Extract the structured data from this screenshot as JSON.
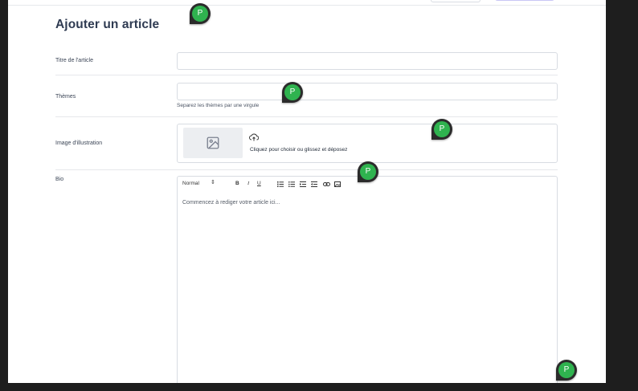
{
  "page": {
    "title": "Ajouter un article"
  },
  "form": {
    "title_label": "Titre de l'article",
    "title_value": "",
    "themes_label": "Thèmes",
    "themes_value": "",
    "themes_help": "Separez les thèmes par une virgule",
    "image_label": "Image d'illustration",
    "image_dropzone_text": "Cliquez pour choisir ou glissez et déposez",
    "bio_label": "Bio"
  },
  "editor": {
    "format_select": "Normal",
    "bold": "B",
    "italic": "I",
    "underline": "U",
    "placeholder": "Commencez à rediger votre article ici...",
    "icons": [
      "ordered-list-icon",
      "bullet-list-icon",
      "indent-icon",
      "outdent-icon",
      "link-icon",
      "image-icon"
    ]
  },
  "avatars": {
    "initial": "P",
    "color": "#2fb34f"
  },
  "colors": {
    "title": "#2f3b52",
    "border": "#d8dce2",
    "background": "#1e1e1e"
  }
}
